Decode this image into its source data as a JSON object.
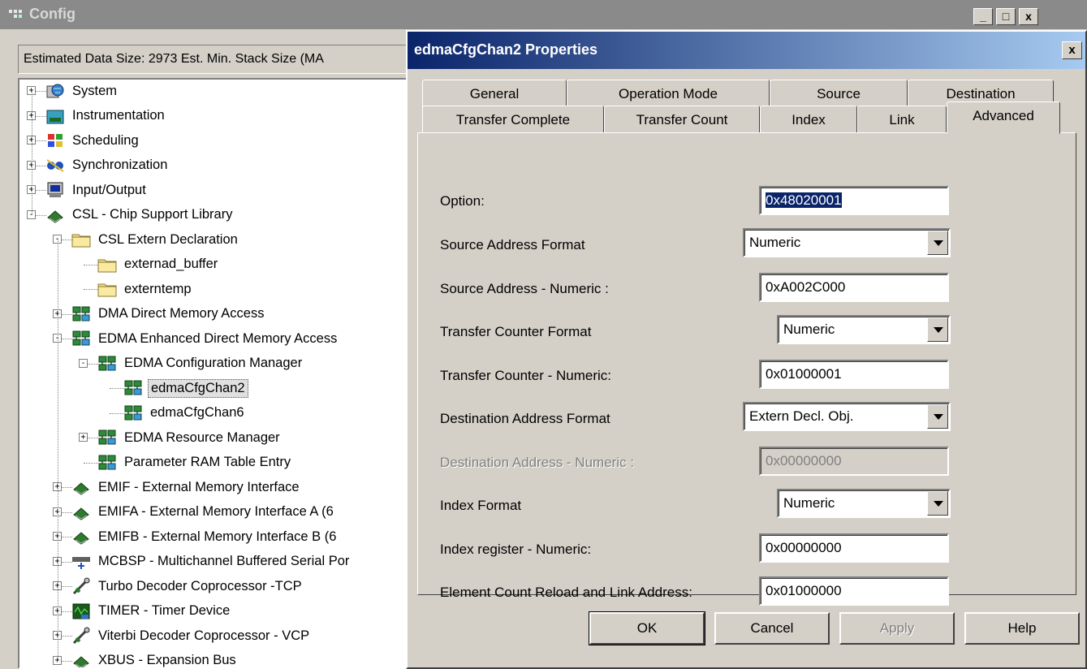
{
  "config_window": {
    "title": "Config",
    "minimize_glyph": "_",
    "maximize_glyph": "□",
    "close_glyph": "x",
    "status_text": "Estimated Data Size: 2973   Est. Min. Stack Size (MA"
  },
  "tree": {
    "items": [
      {
        "label": "System",
        "icon": "system-globe-icon"
      },
      {
        "label": "Instrumentation",
        "icon": "instrumentation-icon"
      },
      {
        "label": "Scheduling",
        "icon": "scheduling-icon"
      },
      {
        "label": "Synchronization",
        "icon": "synchronization-icon"
      },
      {
        "label": "Input/Output",
        "icon": "io-monitor-icon"
      },
      {
        "label": "CSL - Chip Support Library",
        "icon": "chip-icon"
      },
      {
        "label": "CSL Extern Declaration",
        "icon": "folder-icon"
      },
      {
        "label": "externad_buffer",
        "icon": "folder-icon"
      },
      {
        "label": "externtemp",
        "icon": "folder-icon"
      },
      {
        "label": "DMA Direct Memory Access",
        "icon": "module-icon"
      },
      {
        "label": "EDMA Enhanced Direct Memory Access",
        "icon": "module-icon"
      },
      {
        "label": "EDMA Configuration Manager",
        "icon": "module-icon"
      },
      {
        "label": "edmaCfgChan2",
        "icon": "module-icon"
      },
      {
        "label": "edmaCfgChan6",
        "icon": "module-icon"
      },
      {
        "label": "EDMA Resource Manager",
        "icon": "module-icon"
      },
      {
        "label": "Parameter RAM Table Entry",
        "icon": "module-icon"
      },
      {
        "label": "EMIF - External Memory Interface",
        "icon": "chip-icon"
      },
      {
        "label": "EMIFA - External Memory Interface A (6",
        "icon": "chip-icon"
      },
      {
        "label": "EMIFB - External Memory Interface B (6",
        "icon": "chip-icon"
      },
      {
        "label": "MCBSP - Multichannel Buffered Serial Por",
        "icon": "serial-port-icon"
      },
      {
        "label": "Turbo Decoder Coprocessor -TCP",
        "icon": "satellite-icon"
      },
      {
        "label": "TIMER - Timer Device",
        "icon": "timer-icon"
      },
      {
        "label": "Viterbi Decoder Coprocessor - VCP",
        "icon": "satellite-icon"
      },
      {
        "label": "XBUS - Expansion Bus",
        "icon": "chip-icon"
      }
    ]
  },
  "dialog": {
    "title": "edmaCfgChan2 Properties",
    "close_glyph": "x",
    "tabs_back": [
      "General",
      "Operation Mode",
      "Source",
      "Destination"
    ],
    "tabs_front": [
      "Transfer Complete",
      "Transfer Count",
      "Index",
      "Link",
      "Advanced"
    ],
    "active_tab": "Advanced",
    "fields": {
      "option": {
        "label": "Option:",
        "value": "0x48020001"
      },
      "source_address_format": {
        "label": "Source Address Format",
        "value": "Numeric"
      },
      "source_address_numeric": {
        "label": "Source Address - Numeric :",
        "value": "0xA002C000"
      },
      "transfer_counter_format": {
        "label": "Transfer Counter Format",
        "value": "Numeric"
      },
      "transfer_counter_numeric": {
        "label": "Transfer Counter - Numeric:",
        "value": "0x01000001"
      },
      "destination_address_format": {
        "label": "Destination Address Format",
        "value": "Extern Decl. Obj."
      },
      "destination_address_numeric": {
        "label": "Destination Address - Numeric :",
        "value": "0x00000000"
      },
      "index_format": {
        "label": "Index Format",
        "value": "Numeric"
      },
      "index_register_numeric": {
        "label": "Index register - Numeric:",
        "value": "0x00000000"
      },
      "element_count_reload": {
        "label": "Element Count Reload and Link Address:",
        "value": "0x01000000"
      }
    },
    "buttons": {
      "ok": "OK",
      "cancel": "Cancel",
      "apply": "Apply",
      "help": "Help"
    }
  },
  "colors": {
    "dialog_title_start": "#0a246a",
    "dialog_title_end": "#a6caf0",
    "inactive_title": "#8a8a8a",
    "face": "#d4d0c8"
  }
}
